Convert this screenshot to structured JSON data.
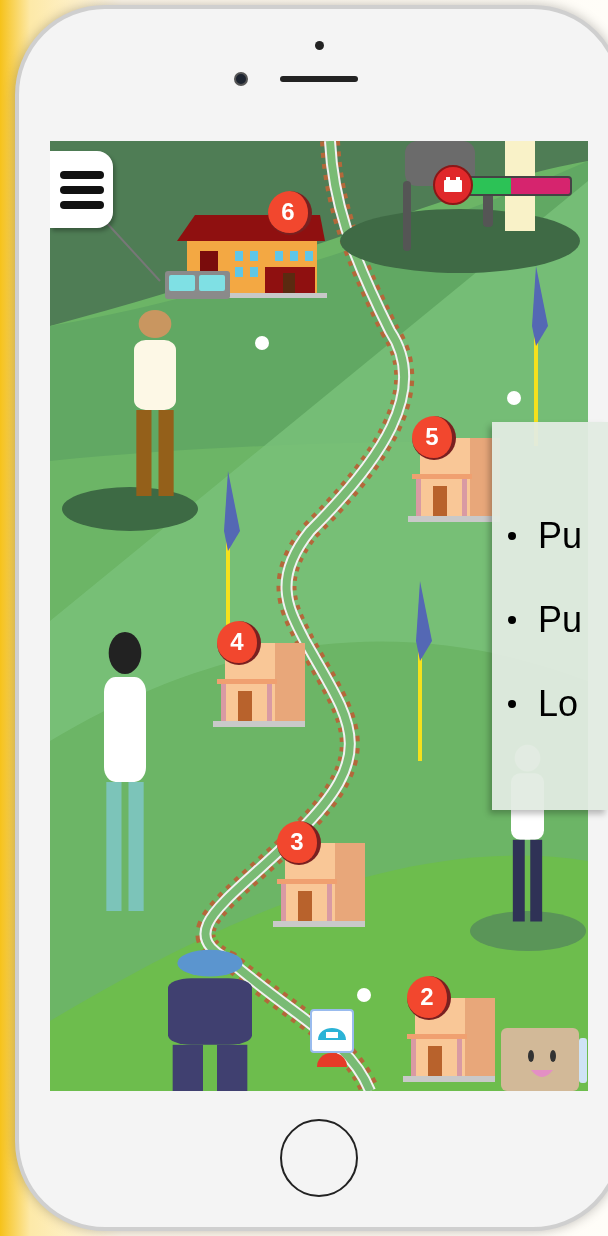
{
  "map": {
    "stations": [
      {
        "kind": "depot",
        "number": "6"
      },
      {
        "kind": "house",
        "number": "5"
      },
      {
        "kind": "house",
        "number": "4"
      },
      {
        "kind": "house",
        "number": "3"
      },
      {
        "kind": "house",
        "number": "2"
      }
    ],
    "progress": {
      "level": 0.45
    }
  },
  "overlay": {
    "bullets": [
      "Pu",
      "Pu",
      "Lo"
    ]
  }
}
